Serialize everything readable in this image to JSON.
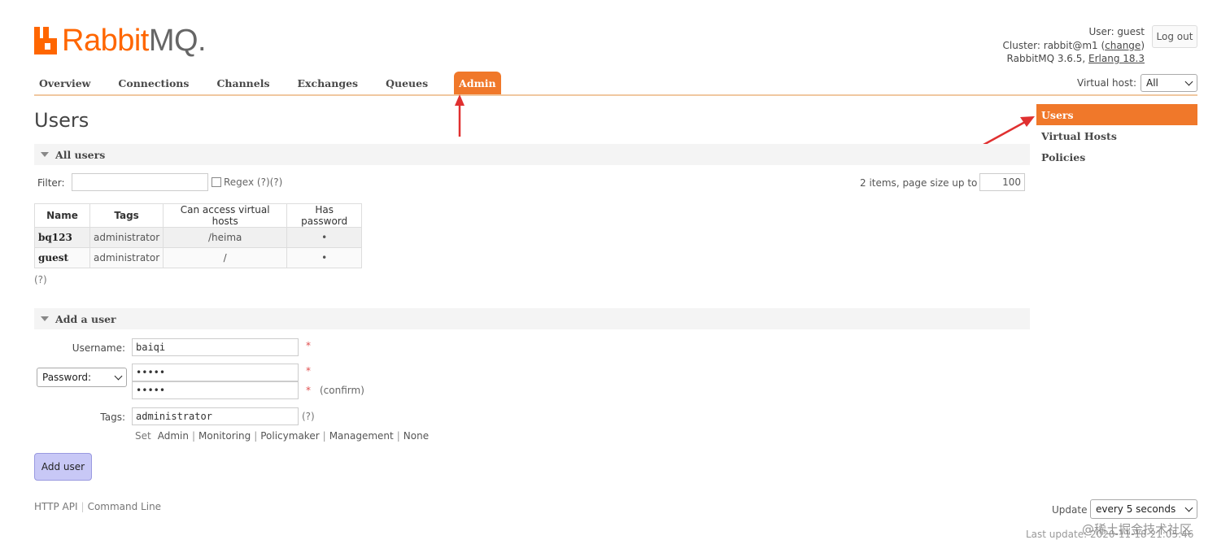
{
  "header": {
    "logo_text_brand": "Rabbit",
    "logo_text_mq": "MQ.",
    "user_line": "User: guest",
    "cluster_prefix": "Cluster: rabbit@m1 (",
    "cluster_change": "change",
    "cluster_suffix": ")",
    "version_prefix": "RabbitMQ 3.6.5, ",
    "erlang": "Erlang 18.3",
    "logout": "Log out"
  },
  "nav": {
    "tabs": [
      "Overview",
      "Connections",
      "Channels",
      "Exchanges",
      "Queues",
      "Admin"
    ],
    "active": "Admin",
    "vhost_label": "Virtual host:",
    "vhost_value": "All"
  },
  "page": {
    "title": "Users"
  },
  "sidebar": {
    "items": [
      "Users",
      "Virtual Hosts",
      "Policies"
    ],
    "active": "Users"
  },
  "all_users": {
    "heading": "All users",
    "filter_label": "Filter:",
    "filter_value": "",
    "regex_label": "Regex (?)(?)",
    "items_text": "2 items, page size up to",
    "page_size": "100",
    "columns": [
      "Name",
      "Tags",
      "Can access virtual hosts",
      "Has password"
    ],
    "rows": [
      {
        "name": "bq123",
        "tags": "administrator",
        "vhosts": "/heima",
        "has_password": "•"
      },
      {
        "name": "guest",
        "tags": "administrator",
        "vhosts": "/",
        "has_password": "•"
      }
    ],
    "help": "(?)"
  },
  "add_user": {
    "heading": "Add a user",
    "username_label": "Username:",
    "username_value": "baiqi",
    "password_select": "Password:",
    "password_value": "•••••",
    "confirm_value": "•••••",
    "required_mark": "*",
    "confirm_label": "(confirm)",
    "tags_label": "Tags:",
    "tags_value": "administrator",
    "tags_help": "(?)",
    "set_label": "Set",
    "tag_options": [
      "Admin",
      "Monitoring",
      "Policymaker",
      "Management",
      "None"
    ],
    "submit": "Add user"
  },
  "footer": {
    "links": [
      "HTTP API",
      "Command Line"
    ],
    "update_label": "Update",
    "update_value": "every 5 seconds",
    "last_update": "Last update: 2020-11-18 21:05:46",
    "watermark": "@稀土掘金技术社区"
  },
  "colors": {
    "accent": "#f0782a",
    "button": "#c8c8f6"
  }
}
